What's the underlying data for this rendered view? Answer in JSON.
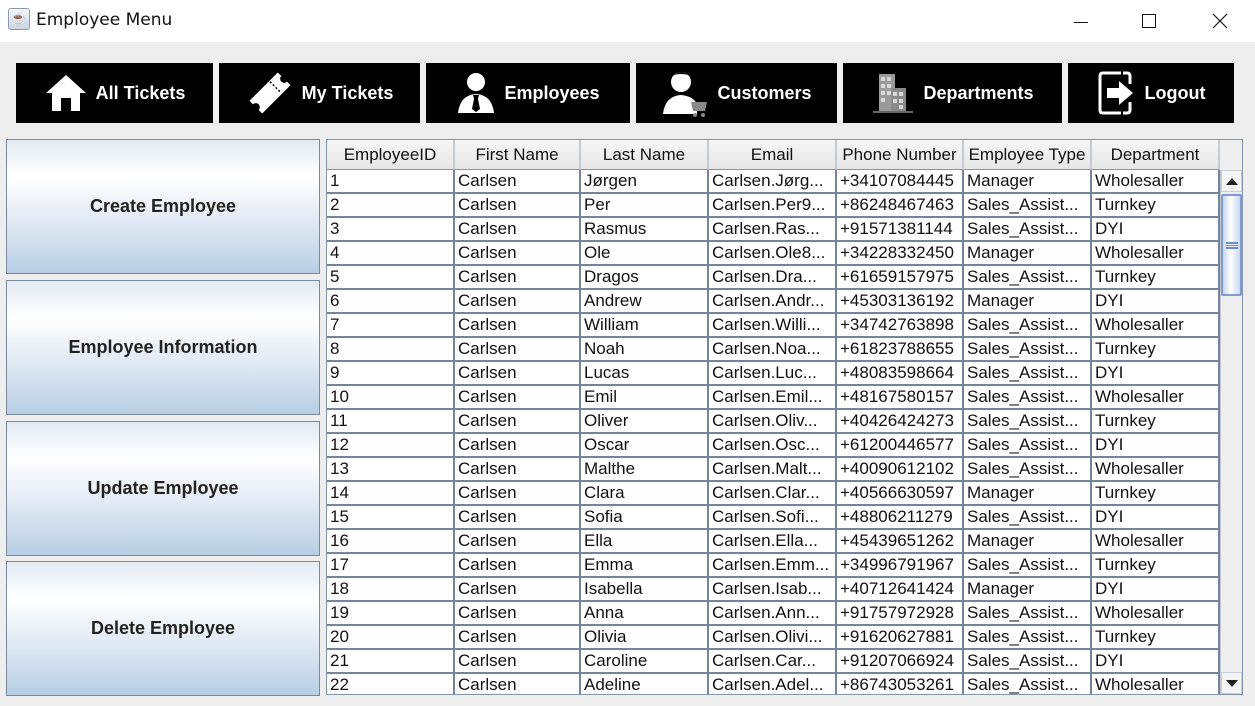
{
  "window": {
    "title": "Employee Menu",
    "app_icon": "java-cup-icon",
    "controls": [
      "minimize",
      "maximize",
      "close"
    ]
  },
  "nav": [
    {
      "label": "All Tickets",
      "icon": "home-icon"
    },
    {
      "label": "My Tickets",
      "icon": "ticket-icon"
    },
    {
      "label": "Employees",
      "icon": "employee-icon"
    },
    {
      "label": "Customers",
      "icon": "customer-cart-icon"
    },
    {
      "label": "Departments",
      "icon": "building-icon"
    },
    {
      "label": "Logout",
      "icon": "logout-icon"
    }
  ],
  "sidebar": [
    {
      "label": "Create Employee"
    },
    {
      "label": "Employee Information"
    },
    {
      "label": "Update Employee"
    },
    {
      "label": "Delete Employee"
    }
  ],
  "table": {
    "columns": [
      "EmployeeID",
      "First Name",
      "Last Name",
      "Email",
      "Phone Number",
      "Employee Type",
      "Department"
    ],
    "rows": [
      [
        "1",
        "Carlsen",
        "Jørgen",
        "Carlsen.Jørg...",
        "+34107084445",
        "Manager",
        "Wholesaller"
      ],
      [
        "2",
        "Carlsen",
        "Per",
        "Carlsen.Per9...",
        "+86248467463",
        "Sales_Assist...",
        "Turnkey"
      ],
      [
        "3",
        "Carlsen",
        "Rasmus",
        "Carlsen.Ras...",
        "+91571381144",
        "Sales_Assist...",
        "DYI"
      ],
      [
        "4",
        "Carlsen",
        "Ole",
        "Carlsen.Ole8...",
        "+34228332450",
        "Manager",
        "Wholesaller"
      ],
      [
        "5",
        "Carlsen",
        "Dragos",
        "Carlsen.Dra...",
        "+61659157975",
        "Sales_Assist...",
        "Turnkey"
      ],
      [
        "6",
        "Carlsen",
        "Andrew",
        "Carlsen.Andr...",
        "+45303136192",
        "Manager",
        "DYI"
      ],
      [
        "7",
        "Carlsen",
        "William",
        "Carlsen.Willi...",
        "+34742763898",
        "Sales_Assist...",
        "Wholesaller"
      ],
      [
        "8",
        "Carlsen",
        "Noah",
        "Carlsen.Noa...",
        "+61823788655",
        "Sales_Assist...",
        "Turnkey"
      ],
      [
        "9",
        "Carlsen",
        "Lucas",
        "Carlsen.Luc...",
        "+48083598664",
        "Sales_Assist...",
        "DYI"
      ],
      [
        "10",
        "Carlsen",
        "Emil",
        "Carlsen.Emil...",
        "+48167580157",
        "Sales_Assist...",
        "Wholesaller"
      ],
      [
        "11",
        "Carlsen",
        "Oliver",
        "Carlsen.Oliv...",
        "+40426424273",
        "Sales_Assist...",
        "Turnkey"
      ],
      [
        "12",
        "Carlsen",
        "Oscar",
        "Carlsen.Osc...",
        "+61200446577",
        "Sales_Assist...",
        "DYI"
      ],
      [
        "13",
        "Carlsen",
        "Malthe",
        "Carlsen.Malt...",
        "+40090612102",
        "Sales_Assist...",
        "Wholesaller"
      ],
      [
        "14",
        "Carlsen",
        "Clara",
        "Carlsen.Clar...",
        "+40566630597",
        "Manager",
        "Turnkey"
      ],
      [
        "15",
        "Carlsen",
        "Sofia",
        "Carlsen.Sofi...",
        "+48806211279",
        "Sales_Assist...",
        "DYI"
      ],
      [
        "16",
        "Carlsen",
        "Ella",
        "Carlsen.Ella...",
        "+45439651262",
        "Manager",
        "Wholesaller"
      ],
      [
        "17",
        "Carlsen",
        "Emma",
        "Carlsen.Emm...",
        "+34996791967",
        "Sales_Assist...",
        "Turnkey"
      ],
      [
        "18",
        "Carlsen",
        "Isabella",
        "Carlsen.Isab...",
        "+40712641424",
        "Manager",
        "DYI"
      ],
      [
        "19",
        "Carlsen",
        "Anna",
        "Carlsen.Ann...",
        "+91757972928",
        "Sales_Assist...",
        "Wholesaller"
      ],
      [
        "20",
        "Carlsen",
        "Olivia",
        "Carlsen.Olivi...",
        "+91620627881",
        "Sales_Assist...",
        "Turnkey"
      ],
      [
        "21",
        "Carlsen",
        "Caroline",
        "Carlsen.Car...",
        "+91207066924",
        "Sales_Assist...",
        "DYI"
      ],
      [
        "22",
        "Carlsen",
        "Adeline",
        "Carlsen.Adel...",
        "+86743053261",
        "Sales_Assist...",
        "Wholesaller"
      ]
    ]
  },
  "scrollbar": {
    "position_fraction": 0.0
  }
}
